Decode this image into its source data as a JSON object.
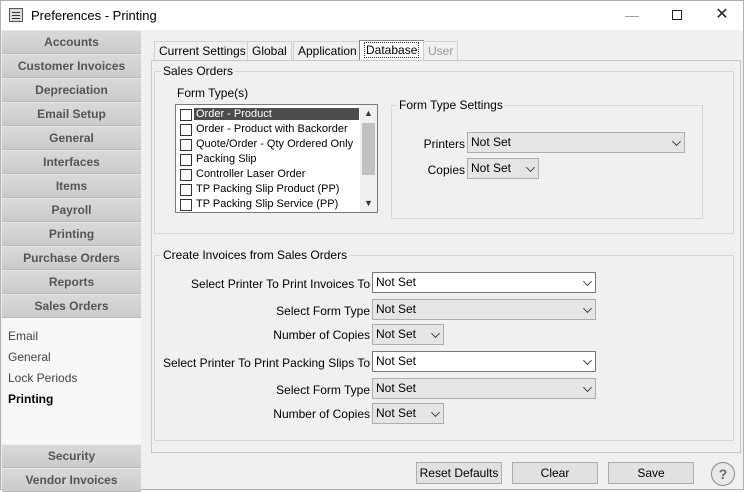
{
  "window": {
    "title": "Preferences - Printing",
    "min": "—",
    "close": "✕"
  },
  "sidebar": {
    "top_items": [
      "Accounts",
      "Customer Invoices",
      "Depreciation",
      "Email Setup",
      "General",
      "Interfaces",
      "Items",
      "Payroll",
      "Printing",
      "Purchase Orders",
      "Reports",
      "Sales Orders"
    ],
    "sub_items": [
      "Email",
      "General",
      "Lock Periods",
      "Printing"
    ],
    "active_sub": "Printing",
    "bottom_items": [
      "Security",
      "Vendor Invoices"
    ]
  },
  "tabs": [
    "Current Settings",
    "Global",
    "Application",
    "Database",
    "User"
  ],
  "active_tab": "Database",
  "sales_orders": {
    "group_title": "Sales Orders",
    "form_types_label": "Form Type(s)",
    "form_types": [
      {
        "label": "Order - Product",
        "checked": false,
        "selected": true
      },
      {
        "label": "Order - Product with Backorder",
        "checked": false
      },
      {
        "label": "Quote/Order - Qty Ordered Only",
        "checked": false
      },
      {
        "label": "Packing Slip",
        "checked": false
      },
      {
        "label": "Controller Laser Order",
        "checked": false
      },
      {
        "label": "TP Packing Slip Product (PP)",
        "checked": false
      },
      {
        "label": "TP Packing Slip Service (PP)",
        "checked": false
      }
    ],
    "settings_title": "Form Type Settings",
    "printers_label": "Printers",
    "printers_value": "Not Set",
    "copies_label": "Copies",
    "copies_value": "Not Set"
  },
  "create_invoices": {
    "group_title": "Create Invoices from Sales Orders",
    "invoice_printer_label": "Select Printer To Print Invoices To",
    "invoice_printer_value": "Not Set",
    "invoice_form_label": "Select Form Type",
    "invoice_form_value": "Not Set",
    "invoice_copies_label": "Number of Copies",
    "invoice_copies_value": "Not Set",
    "slip_printer_label": "Select Printer To Print Packing Slips To",
    "slip_printer_value": "Not Set",
    "slip_form_label": "Select Form Type",
    "slip_form_value": "Not Set",
    "slip_copies_label": "Number of Copies",
    "slip_copies_value": "Not Set"
  },
  "buttons": {
    "reset": "Reset Defaults",
    "clear": "Clear",
    "save": "Save",
    "help": "?"
  }
}
